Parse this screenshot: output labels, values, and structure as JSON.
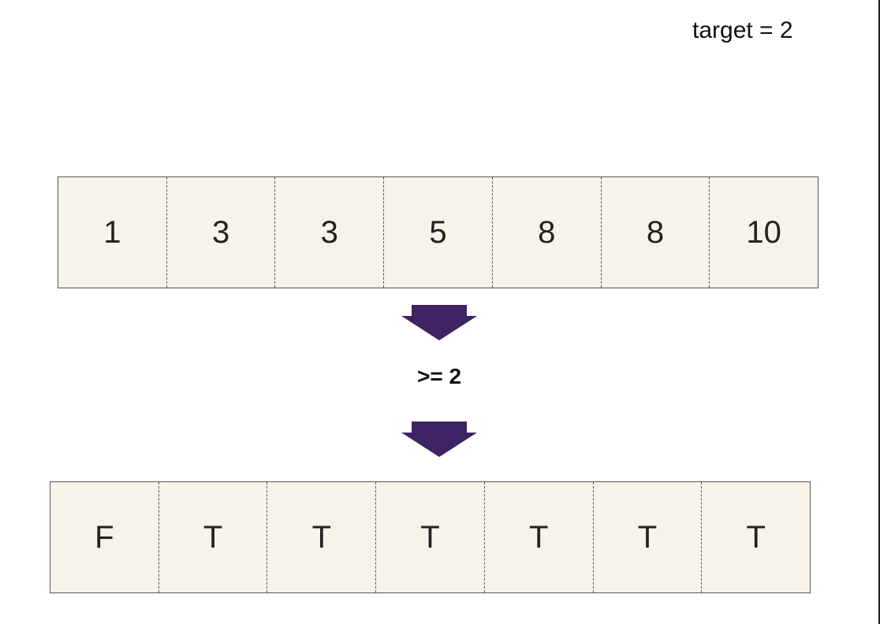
{
  "target_label": "target = 2",
  "input_array": [
    "1",
    "3",
    "3",
    "5",
    "8",
    "8",
    "10"
  ],
  "condition_label": ">= 2",
  "output_array": [
    "F",
    "T",
    "T",
    "T",
    "T",
    "T",
    "T"
  ],
  "colors": {
    "cell_fill": "#f7f3e8",
    "arrow": "#3f2463"
  }
}
